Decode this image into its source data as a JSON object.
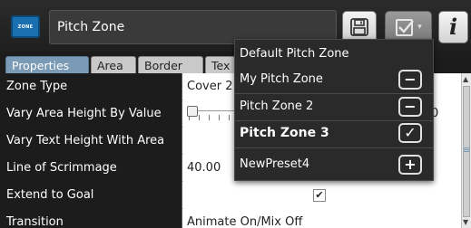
{
  "header": {
    "zone_icon_label": "ZONE",
    "title": "Pitch Zone",
    "save_icon": "save-floppy-icon",
    "preset_icon": "preset-check-icon",
    "preset_caret": "▾",
    "info_label": "i"
  },
  "tabs": [
    {
      "label": "Properties",
      "active": true
    },
    {
      "label": "Area",
      "active": false
    },
    {
      "label": "Border",
      "active": false
    },
    {
      "label": "Tex",
      "active": false
    }
  ],
  "properties": [
    {
      "label": "Zone Type",
      "value": "Cover 2"
    },
    {
      "label": "Vary Area Height By Value",
      "value": ""
    },
    {
      "label": "Vary Text Height With Area",
      "value": ""
    },
    {
      "label": "Line of Scrimmage",
      "value": "40.00"
    },
    {
      "label": "Extend to Goal",
      "value": "",
      "checked": true
    },
    {
      "label": "Transition",
      "value": "Animate On/Mix Off"
    }
  ],
  "row2_value_peek": "0",
  "presets_menu": {
    "items": [
      {
        "label": "Default Pitch Zone",
        "action": ""
      },
      {
        "label": "My Pitch Zone",
        "action": "−"
      },
      {
        "label": "Pitch Zone 2",
        "action": "−"
      },
      {
        "label": "Pitch Zone 3",
        "action": "✓",
        "selected": true
      },
      {
        "label": "NewPreset4",
        "action": "+"
      }
    ]
  },
  "colors": {
    "background": "#1c1c1c",
    "active_tab": "#7a9ab5",
    "zone_icon": "#1a6fb0"
  }
}
